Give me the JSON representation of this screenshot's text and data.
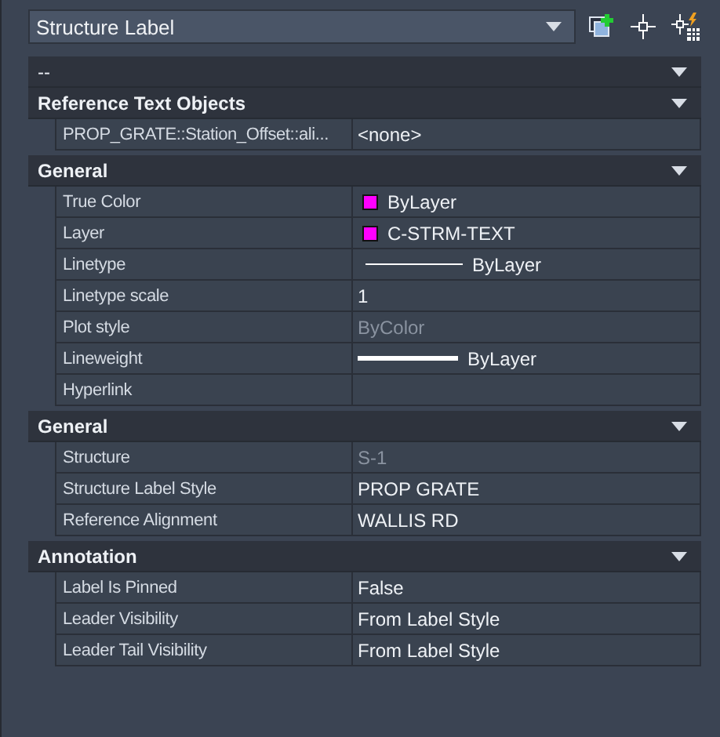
{
  "object_selector": {
    "value": "Structure Label"
  },
  "filter_row": {
    "label": "--"
  },
  "sections": [
    {
      "title": "Reference Text Objects",
      "expanded": true,
      "rows": [
        {
          "name": "PROP_GRATE::Station_Offset::ali...",
          "kind": "text",
          "value": "<none>"
        }
      ]
    },
    {
      "title": "General",
      "expanded": true,
      "rows": [
        {
          "name": "True Color",
          "kind": "color",
          "color": "#ff00ff",
          "value": "ByLayer"
        },
        {
          "name": "Layer",
          "kind": "color",
          "color": "#ff00ff",
          "value": "C-STRM-TEXT"
        },
        {
          "name": "Linetype",
          "kind": "line",
          "value": "ByLayer"
        },
        {
          "name": "Linetype scale",
          "kind": "text",
          "value": "1"
        },
        {
          "name": "Plot style",
          "kind": "text",
          "value": "ByColor",
          "disabled": true
        },
        {
          "name": "Lineweight",
          "kind": "heavy-line",
          "value": "ByLayer"
        },
        {
          "name": "Hyperlink",
          "kind": "empty"
        }
      ]
    },
    {
      "title": "General",
      "expanded": true,
      "rows": [
        {
          "name": "Structure",
          "kind": "text",
          "value": "S-1",
          "disabled": true
        },
        {
          "name": "Structure Label Style",
          "kind": "text",
          "value": "PROP GRATE"
        },
        {
          "name": "Reference Alignment",
          "kind": "text",
          "value": "WALLIS RD"
        }
      ]
    },
    {
      "title": "Annotation",
      "expanded": true,
      "rows": [
        {
          "name": "Label Is Pinned",
          "kind": "text",
          "value": "False"
        },
        {
          "name": "Leader Visibility",
          "kind": "text",
          "value": "From Label Style"
        },
        {
          "name": "Leader Tail Visibility",
          "kind": "text",
          "value": "From Label Style"
        }
      ]
    }
  ]
}
